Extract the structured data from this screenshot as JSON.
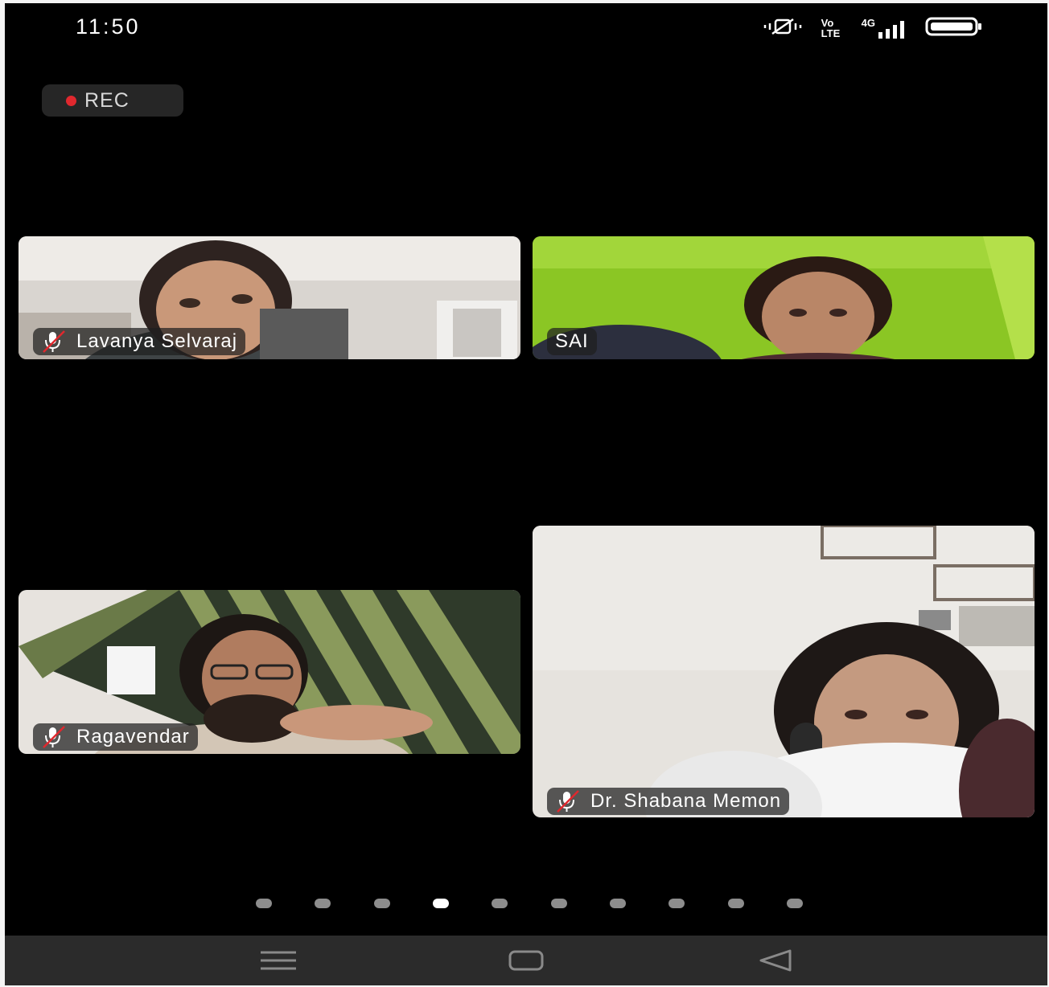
{
  "status_bar": {
    "time": "11:50",
    "network_label": "4G",
    "volte_label": "Vo LTE",
    "icons": [
      "vibrate-icon",
      "volte-icon",
      "signal-icon",
      "battery-icon"
    ]
  },
  "recording": {
    "label": "REC",
    "dot_color": "#e0282e"
  },
  "participants": [
    {
      "name": "Lavanya Selvaraj",
      "muted": true
    },
    {
      "name": "SAI",
      "muted": false
    },
    {
      "name": "Ragavendar",
      "muted": true
    },
    {
      "name": "Dr. Shabana Memon",
      "muted": true
    }
  ],
  "pagination": {
    "total": 10,
    "active_index": 3
  },
  "nav_bar": {
    "buttons": [
      "menu-icon",
      "home-icon",
      "back-icon"
    ]
  }
}
